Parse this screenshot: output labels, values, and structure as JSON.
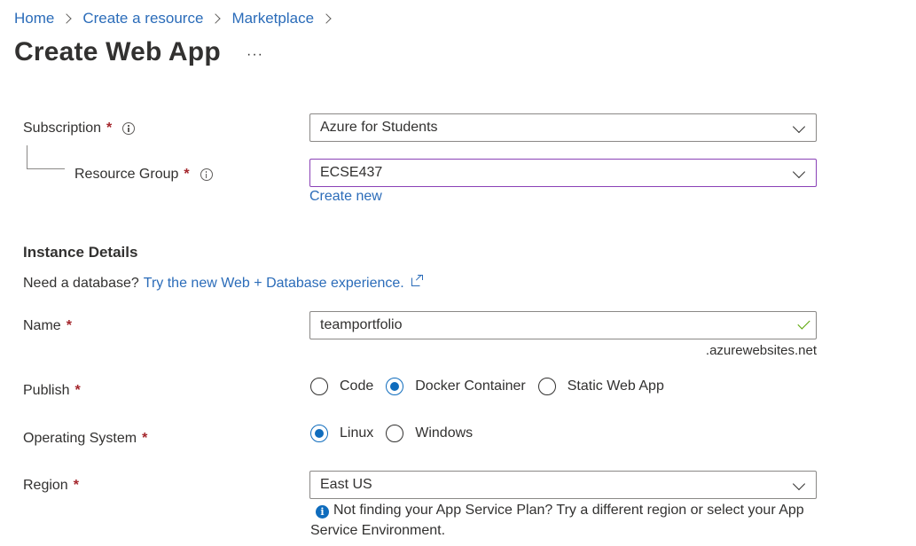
{
  "breadcrumb": [
    "Home",
    "Create a resource",
    "Marketplace"
  ],
  "page_title": "Create Web App",
  "more_label": "···",
  "subscription": {
    "label": "Subscription",
    "required": "*",
    "value": "Azure for Students"
  },
  "resource_group": {
    "label": "Resource Group",
    "required": "*",
    "value": "ECSE437",
    "create_new": "Create new"
  },
  "instance": {
    "header": "Instance Details",
    "db_prompt": "Need a database?",
    "db_link": "Try the new Web + Database experience."
  },
  "name": {
    "label": "Name",
    "required": "*",
    "value": "teamportfolio",
    "suffix": ".azurewebsites.net"
  },
  "publish": {
    "label": "Publish",
    "required": "*",
    "options": [
      "Code",
      "Docker Container",
      "Static Web App"
    ],
    "selected": "Docker Container"
  },
  "os": {
    "label": "Operating System",
    "required": "*",
    "options": [
      "Linux",
      "Windows"
    ],
    "selected": "Linux"
  },
  "region": {
    "label": "Region",
    "required": "*",
    "value": "East US",
    "note": "Not finding your App Service Plan? Try a different region or select your App Service Environment."
  },
  "colors": {
    "link": "#2b6cb9",
    "required": "#a4262c",
    "radio_checked": "#0f6cbd",
    "focus_border": "#8a41b6",
    "valid_check": "#57a300"
  },
  "icons": [
    "chevron-right-icon",
    "info-icon",
    "chevron-down-icon",
    "check-icon",
    "external-link-icon",
    "info-filled-icon"
  ]
}
